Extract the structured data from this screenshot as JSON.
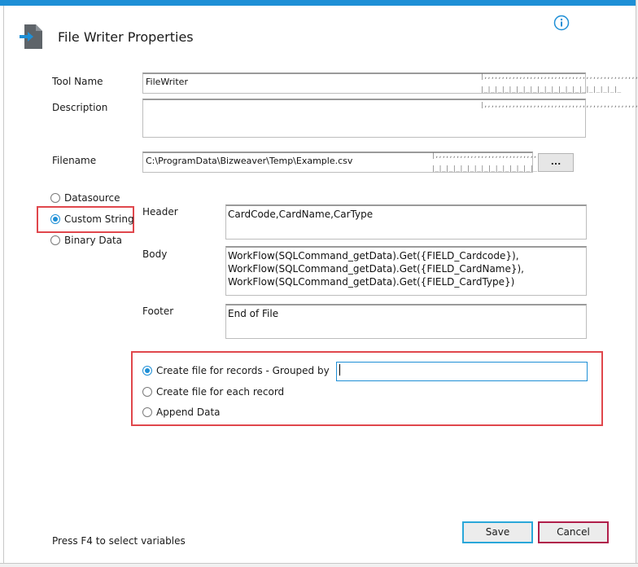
{
  "window": {
    "title": "File Writer Properties",
    "accent_color": "#1e8fd6",
    "icons": {
      "app": "file-writer-icon",
      "info": "info-icon"
    }
  },
  "form": {
    "tool_name": {
      "label": "Tool Name",
      "value": "FileWriter"
    },
    "description": {
      "label": "Description",
      "value": ""
    },
    "filename": {
      "label": "Filename",
      "value": "C:\\ProgramData\\Bizweaver\\Temp\\Example.csv",
      "browse_label": "..."
    }
  },
  "data_type": {
    "options": [
      {
        "label": "Datasource",
        "checked": false
      },
      {
        "label": "Custom String",
        "checked": true
      },
      {
        "label": "Binary Data",
        "checked": false
      }
    ]
  },
  "custom_string": {
    "header": {
      "label": "Header",
      "value": "CardCode,CardName,CarType"
    },
    "body": {
      "label": "Body",
      "value": "WorkFlow(SQLCommand_getData).Get({FIELD_Cardcode}),\nWorkFlow(SQLCommand_getData).Get({FIELD_CardName}),\nWorkFlow(SQLCommand_getData).Get({FIELD_CardType})"
    },
    "footer": {
      "label": "Footer",
      "value": "End of File"
    }
  },
  "file_mode": {
    "options": [
      {
        "label": "Create file for records - Grouped by",
        "checked": true
      },
      {
        "label": "Create file for each record",
        "checked": false
      },
      {
        "label": "Append Data",
        "checked": false
      }
    ],
    "grouped_by_value": ""
  },
  "footer_bar": {
    "hint": "Press F4 to select variables",
    "save_label": "Save",
    "cancel_label": "Cancel",
    "highlight_color": "#e0474c"
  }
}
